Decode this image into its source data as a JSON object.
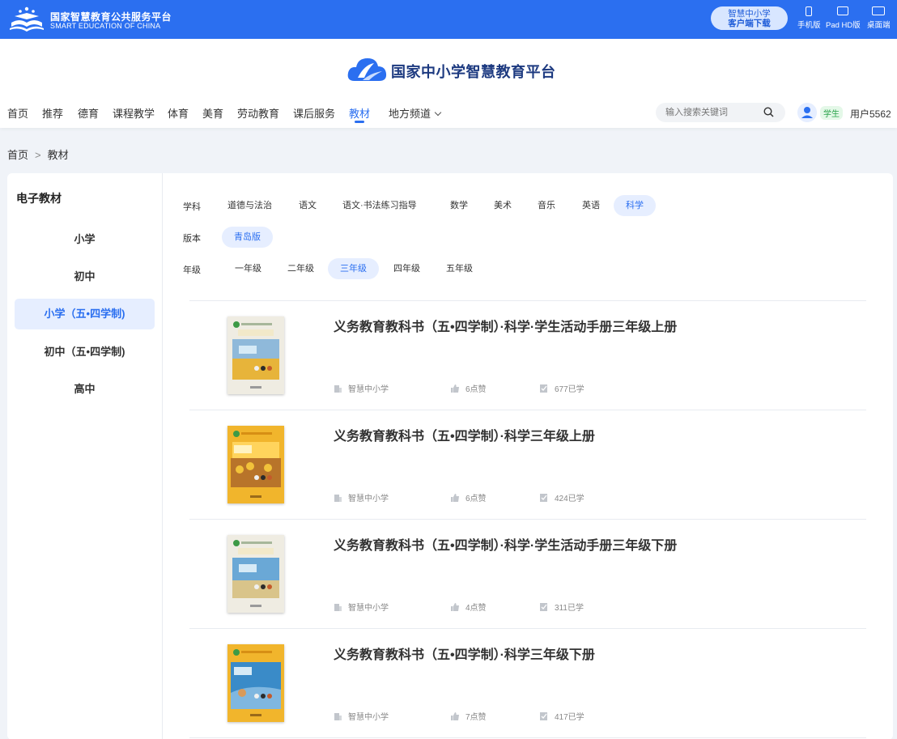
{
  "topbar": {
    "platform_cn": "国家智慧教育公共服务平台",
    "platform_en": "SMART EDUCATION OF CHINA",
    "download_line1": "智慧中小学",
    "download_line2": "客户端下载",
    "devices": [
      "手机版",
      "Pad HD版",
      "桌面端"
    ]
  },
  "header": {
    "brand": "国家中小学智慧教育平台",
    "nav": [
      "首页",
      "推荐",
      "德育",
      "课程教学",
      "体育",
      "美育",
      "劳动教育",
      "课后服务",
      "教材",
      "地方频道"
    ],
    "nav_active": "教材",
    "search_placeholder": "输入搜索关键词",
    "role": "学生",
    "username": "用户5562"
  },
  "breadcrumb": {
    "home": "首页",
    "sep": ">",
    "current": "教材"
  },
  "sidebar": {
    "title": "电子教材",
    "stages": [
      "小学",
      "初中",
      "小学（五•四学制)",
      "初中（五•四学制)",
      "高中"
    ],
    "active": "小学（五•四学制)"
  },
  "filters": {
    "subject_label": "学科",
    "subjects": [
      "道德与法治",
      "语文",
      "语文·书法练习指导",
      "数学",
      "美术",
      "音乐",
      "英语",
      "科学"
    ],
    "subject_active": "科学",
    "edition_label": "版本",
    "editions": [
      "青岛版"
    ],
    "edition_active": "青岛版",
    "grade_label": "年级",
    "grades": [
      "一年级",
      "二年级",
      "三年级",
      "四年级",
      "五年级"
    ],
    "grade_active": "三年级"
  },
  "books": [
    {
      "title": "义务教育教科书（五•四学制）·科学·学生活动手册三年级上册",
      "source": "智慧中小学",
      "likes": "6点赞",
      "learned": "677已学",
      "cover": "workbook"
    },
    {
      "title": "义务教育教科书（五•四学制）·科学三年级上册",
      "source": "智慧中小学",
      "likes": "6点赞",
      "learned": "424已学",
      "cover": "yellow"
    },
    {
      "title": "义务教育教科书（五•四学制）·科学·学生活动手册三年级下册",
      "source": "智慧中小学",
      "likes": "4点赞",
      "learned": "311已学",
      "cover": "workbook"
    },
    {
      "title": "义务教育教科书（五•四学制）·科学三年级下册",
      "source": "智慧中小学",
      "likes": "7点赞",
      "learned": "417已学",
      "cover": "blue"
    }
  ],
  "colors": {
    "primary": "#2b6ff0",
    "active_bg": "#e6eeff",
    "brand_text": "#1d3a80"
  }
}
